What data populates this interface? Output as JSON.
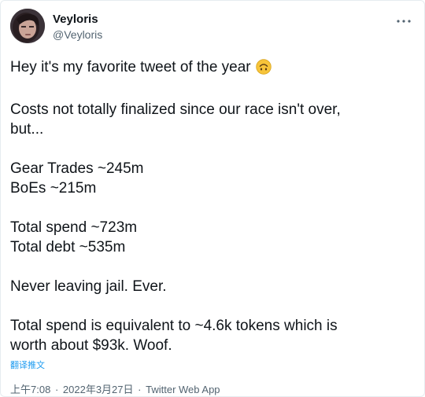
{
  "author": {
    "display_name": "Veyloris",
    "handle": "@Veyloris",
    "avatar_icon": "profile-photo"
  },
  "more_icon": "more-dots-icon",
  "body": {
    "paragraphs": [
      [
        "Hey it's my favorite tweet of the year"
      ],
      [
        "Costs not totally finalized since our race isn't over,",
        "but..."
      ],
      [
        "Gear Trades ~245m",
        "BoEs ~215m"
      ],
      [
        "Total spend ~723m",
        "Total debt ~535m"
      ],
      [
        "Never leaving jail. Ever."
      ],
      [
        "Total spend is equivalent to ~4.6k tokens which is",
        "worth about $93k. Woof."
      ]
    ],
    "emoji": "upside-down-face-emoji"
  },
  "translate_label": "翻译推文",
  "meta": {
    "time": "上午7:08",
    "date": "2022年3月27日",
    "separator": "·",
    "source": "Twitter Web App"
  },
  "colors": {
    "text": "#0f1419",
    "secondary": "#536471",
    "link": "#1d9bf0",
    "emoji_yellow": "#f7c43a"
  }
}
